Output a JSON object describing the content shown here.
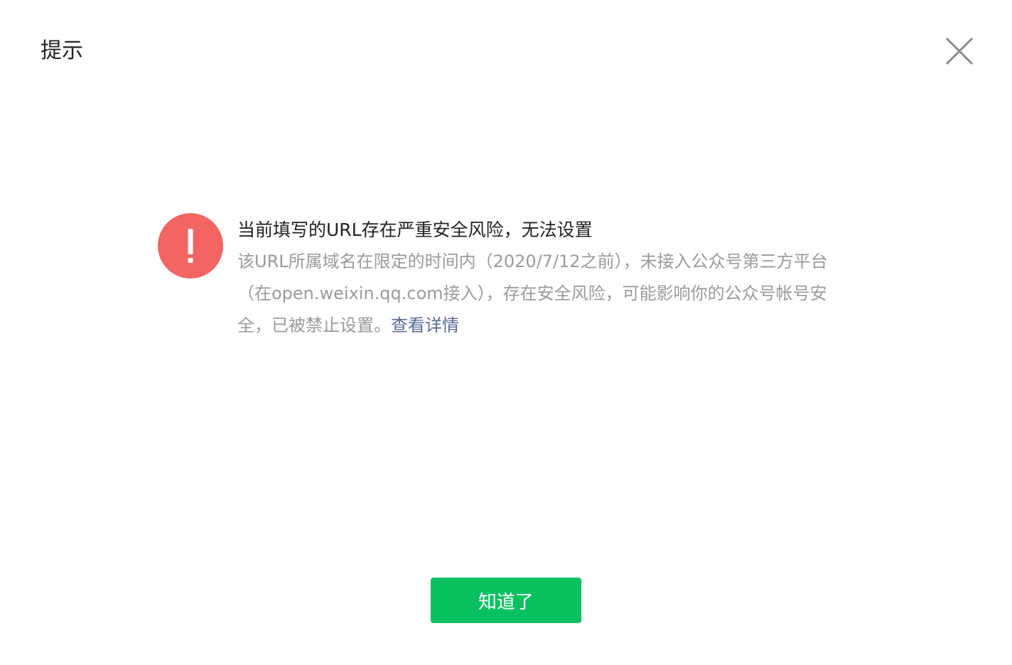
{
  "dialog": {
    "title": "提示",
    "close_icon": "close-icon"
  },
  "alert": {
    "icon": "exclamation-icon",
    "icon_color": "#f26563",
    "title": "当前填写的URL存在严重安全风险，无法设置",
    "body": "该URL所属域名在限定的时间内（2020/7/12之前），未接入公众号第三方平台（在open.weixin.qq.com接入），存在安全风险，可能影响你的公众号帐号安全，已被禁止设置。",
    "link_label": "查看详情",
    "link_color": "#576b95"
  },
  "actions": {
    "confirm_label": "知道了",
    "confirm_color": "#07c160"
  }
}
